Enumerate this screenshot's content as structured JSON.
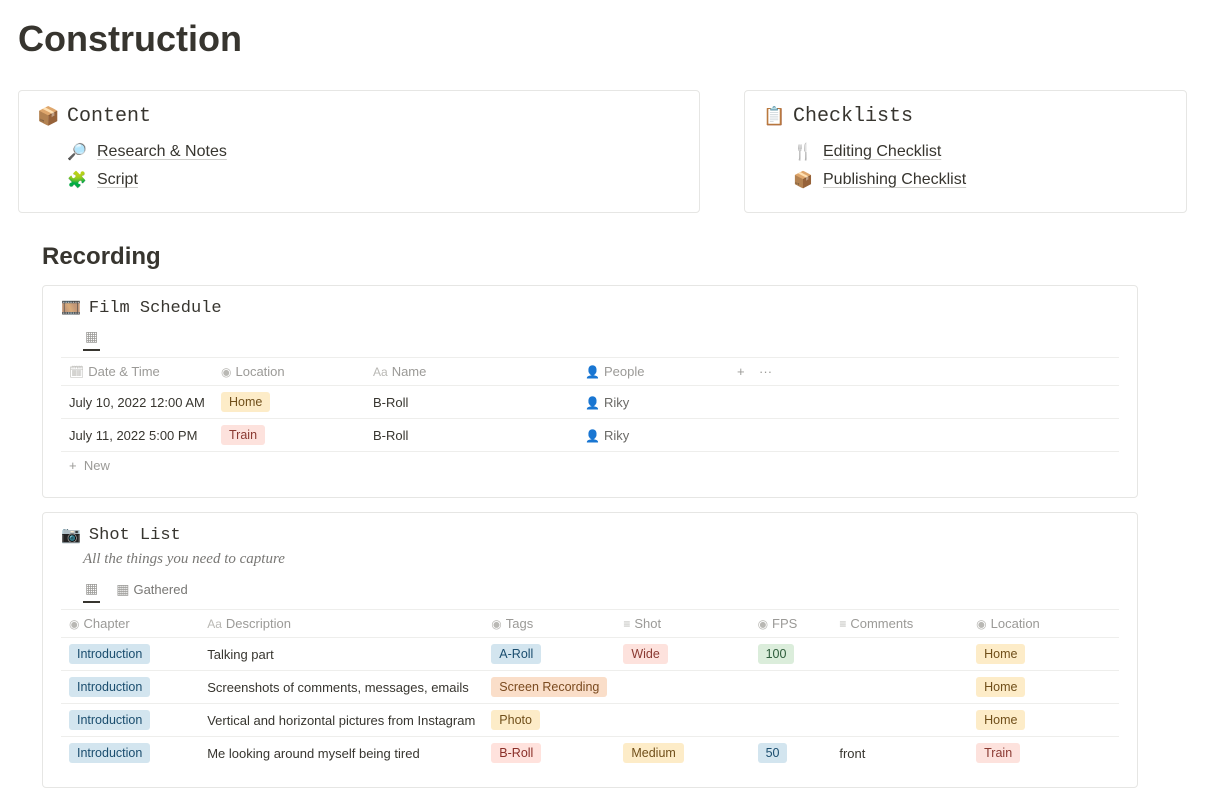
{
  "page": {
    "title": "Construction"
  },
  "content_card": {
    "icon": "📦",
    "title": "Content",
    "links": [
      {
        "icon": "🔎",
        "label": "Research & Notes"
      },
      {
        "icon": "🧩",
        "label": "Script"
      }
    ]
  },
  "checklists_card": {
    "icon": "📋",
    "title": "Checklists",
    "links": [
      {
        "icon": "🍴",
        "label": "Editing Checklist"
      },
      {
        "icon": "📦",
        "label": "Publishing Checklist"
      }
    ]
  },
  "recording": {
    "title": "Recording"
  },
  "film_schedule": {
    "icon": "🎞️",
    "title": "Film Schedule",
    "tabs": [
      {
        "icon": "▦",
        "label": ""
      }
    ],
    "columns": [
      {
        "icon": "🗓",
        "label": "Date & Time"
      },
      {
        "icon": "◉",
        "label": "Location"
      },
      {
        "icon": "Aa",
        "label": "Name"
      },
      {
        "icon": "👤",
        "label": "People"
      }
    ],
    "add_col": "+",
    "more_col": "···",
    "rows": [
      {
        "date": "July 10, 2022 12:00 AM",
        "location": "Home",
        "location_class": "pill-yellow",
        "name": "B-Roll",
        "people": "Riky"
      },
      {
        "date": "July 11, 2022 5:00 PM",
        "location": "Train",
        "location_class": "pill-pink",
        "name": "B-Roll",
        "people": "Riky"
      }
    ],
    "new_label": "New"
  },
  "shot_list": {
    "icon": "📷",
    "title": "Shot List",
    "subtitle": "All the things you need to capture",
    "tabs": [
      {
        "icon": "▦",
        "label": ""
      },
      {
        "icon": "▦",
        "label": "Gathered"
      }
    ],
    "columns": [
      {
        "icon": "◉",
        "label": "Chapter"
      },
      {
        "icon": "Aa",
        "label": "Description"
      },
      {
        "icon": "◉",
        "label": "Tags"
      },
      {
        "icon": "≡",
        "label": "Shot"
      },
      {
        "icon": "◉",
        "label": "FPS"
      },
      {
        "icon": "≡",
        "label": "Comments"
      },
      {
        "icon": "◉",
        "label": "Location"
      }
    ],
    "rows": [
      {
        "chapter": "Introduction",
        "description": "Talking part",
        "tags": "A-Roll",
        "tags_class": "pill-blue",
        "shot": "Wide",
        "shot_class": "pill-pink",
        "fps": "100",
        "fps_class": "pill-green",
        "comments": "",
        "location": "Home",
        "location_class": "pill-yellow"
      },
      {
        "chapter": "Introduction",
        "description": "Screenshots of comments, messages, emails",
        "tags": "Screen Recording",
        "tags_class": "pill-orange",
        "shot": "",
        "shot_class": "",
        "fps": "",
        "fps_class": "",
        "comments": "",
        "location": "Home",
        "location_class": "pill-yellow"
      },
      {
        "chapter": "Introduction",
        "description": "Vertical and horizontal pictures from Instagram",
        "tags": "Photo",
        "tags_class": "pill-yellow",
        "shot": "",
        "shot_class": "",
        "fps": "",
        "fps_class": "",
        "comments": "",
        "location": "Home",
        "location_class": "pill-yellow"
      },
      {
        "chapter": "Introduction",
        "description": "Me looking around myself being tired",
        "tags": "B-Roll",
        "tags_class": "pill-red",
        "shot": "Medium",
        "shot_class": "pill-yellow",
        "fps": "50",
        "fps_class": "pill-blue",
        "comments": "front",
        "location": "Train",
        "location_class": "pill-pink"
      }
    ]
  }
}
